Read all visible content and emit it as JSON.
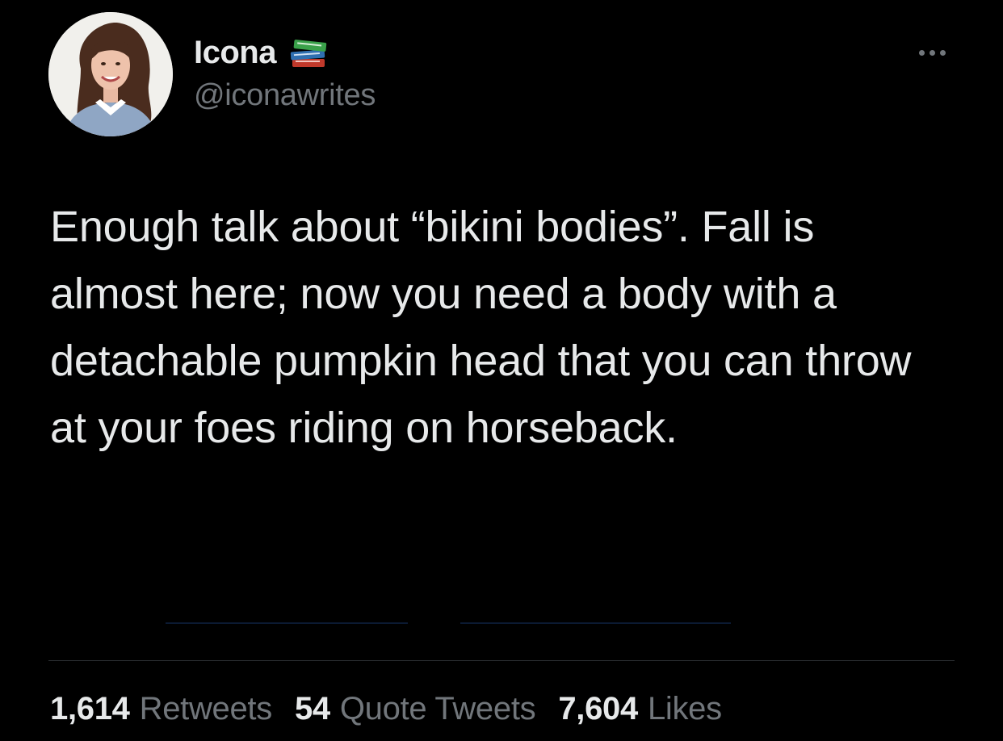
{
  "author": {
    "display_name": "Icona",
    "handle": "@iconawrites",
    "name_emoji": "books-icon",
    "avatar": "avatar-photo"
  },
  "tweet": {
    "text": "Enough talk about “bikini bodies”. Fall is almost here; now you need a body with a detachable pumpkin head that you can throw at your foes riding on horseback."
  },
  "stats": {
    "retweets_count": "1,614",
    "retweets_label": "Retweets",
    "quote_count": "54",
    "quote_label": "Quote Tweets",
    "likes_count": "7,604",
    "likes_label": "Likes"
  },
  "colors": {
    "background": "#000000",
    "primary_text": "#e7e9ea",
    "secondary_text": "#71767b",
    "divider": "#2f3336"
  }
}
